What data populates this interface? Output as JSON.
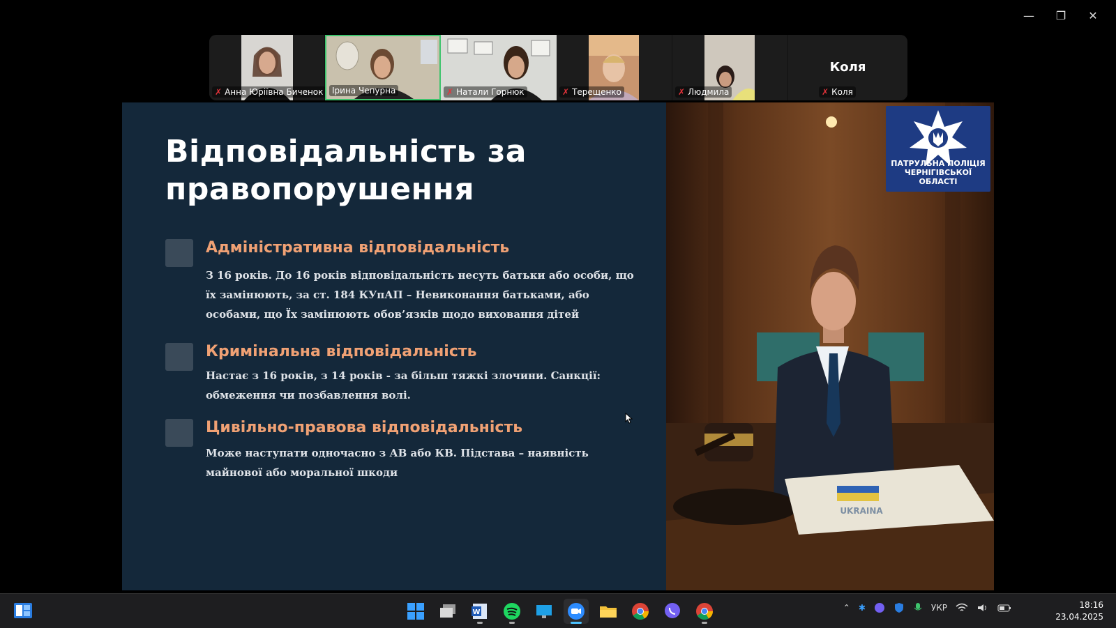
{
  "window": {
    "controls": [
      "minimize",
      "restore",
      "close"
    ]
  },
  "participants": [
    {
      "name": "Анна Юріївна Биченок",
      "muted": true
    },
    {
      "name": "Ірина Чепурна",
      "muted": false,
      "active": true
    },
    {
      "name": "Натали Горнюк",
      "muted": true
    },
    {
      "name": "Терещенко",
      "muted": true
    },
    {
      "name": "Людмила",
      "muted": true
    },
    {
      "name": "Коля",
      "muted": true,
      "display_name": "Коля"
    }
  ],
  "slide": {
    "title": "Відповідальність за правопорушення",
    "items": [
      {
        "heading": "Адміністративна відповідальність",
        "text": "З 16 років. До 16 років відповідальність несуть батьки або особи, що їх замінюють, за ст. 184 КУпАП – Невиконання батьками, або особами, що Їх замінюють обов’язків щодо виховання дітей"
      },
      {
        "heading": "Кримінальна відповідальність",
        "text": "Настає з 16  років, з 14 років - за більш тяжкі злочини. Санкції: обмеження чи позбавлення волі."
      },
      {
        "heading": "Цивільно-правова відповідальність",
        "text": "Може наступати одночасно з АВ або КВ.  Підстава – наявність майнової або моральної шкоди"
      }
    ],
    "badge_text_line1": "ПАТРУЛЬНА ПОЛІЦІЯ",
    "badge_text_line2": "ЧЕРНІГІВСЬКОЇ ОБЛАСТІ",
    "document_text": "UKRAINA"
  },
  "taskbar": {
    "apps": [
      "windows-start",
      "task-view",
      "word",
      "spotify",
      "desktop",
      "zoom",
      "file-explorer",
      "chrome",
      "viber",
      "chrome-2"
    ],
    "language": "УКР",
    "time": "18:16",
    "date": "23.04.2025"
  },
  "colors": {
    "slide_bg": "#14283a",
    "heading": "#f0a174",
    "active_tile": "#3ec46d",
    "badge": "#1e3b83"
  }
}
